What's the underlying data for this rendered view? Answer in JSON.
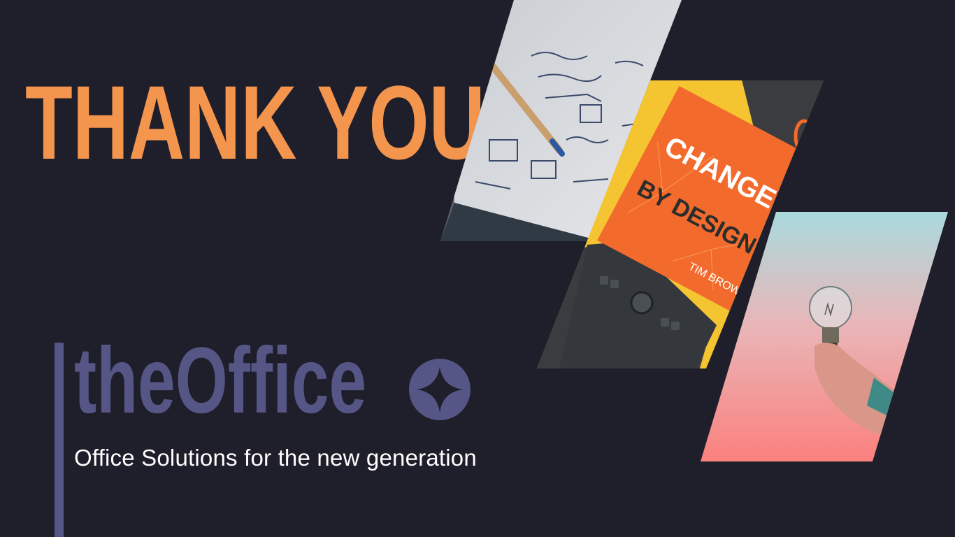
{
  "slide": {
    "heading": "THANK YOU",
    "logo_text": "theOffice",
    "logo_icon": "four-point-star-icon",
    "tagline": "Office Solutions for the new generation"
  },
  "photos": [
    {
      "name": "sketch-notebook-photo",
      "description_icon": "notebook-pencil-image"
    },
    {
      "name": "change-by-design-book-photo",
      "book_title_line1": "CHANGE",
      "book_title_line2": "BY DESIGN",
      "book_author": "TIM BROWN"
    },
    {
      "name": "lightbulb-hand-photo",
      "description_icon": "lightbulb-image"
    }
  ],
  "colors": {
    "background": "#1f1e2b",
    "heading": "#f4954e",
    "logo": "#565686",
    "tagline": "#ffffff"
  }
}
